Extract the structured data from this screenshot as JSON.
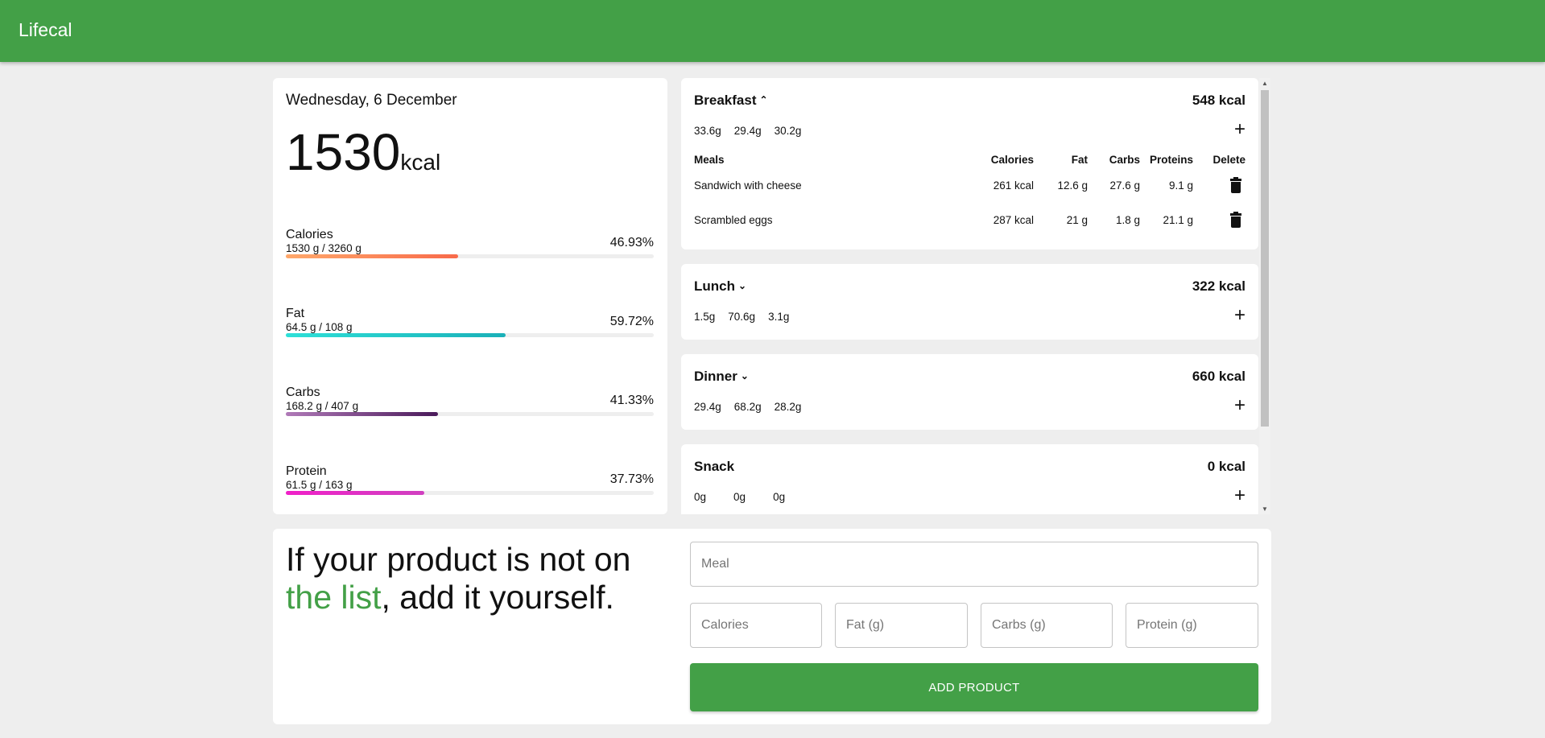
{
  "app": {
    "title": "Lifecal"
  },
  "summary": {
    "date": "Wednesday, 6 December",
    "kcal_value": "1530",
    "kcal_unit": "kcal",
    "stats": [
      {
        "name": "Calories",
        "amount": "1530 g / 3260 g",
        "percent": "46.93%",
        "fill": 0.4693,
        "gradient": [
          "#ffa86b",
          "#f86a4a"
        ]
      },
      {
        "name": "Fat",
        "amount": "64.5 g / 108 g",
        "percent": "59.72%",
        "fill": 0.5972,
        "gradient": [
          "#2ee0d8",
          "#1ab0b8"
        ]
      },
      {
        "name": "Carbs",
        "amount": "168.2 g / 407 g",
        "percent": "41.33%",
        "fill": 0.4133,
        "gradient": [
          "#b07ab8",
          "#4a1a5a"
        ]
      },
      {
        "name": "Protein",
        "amount": "61.5 g / 163 g",
        "percent": "37.73%",
        "fill": 0.3773,
        "gradient": [
          "#f020c8",
          "#d040c0"
        ]
      }
    ]
  },
  "meals": [
    {
      "name": "Breakfast",
      "expanded": true,
      "kcal": "548 kcal",
      "macros": [
        "33.6g",
        "29.4g",
        "30.2g"
      ],
      "table": {
        "headers": [
          "Meals",
          "Calories",
          "Fat",
          "Carbs",
          "Proteins",
          "Delete"
        ],
        "rows": [
          {
            "meal": "Sandwich with cheese",
            "calories": "261 kcal",
            "fat": "12.6 g",
            "carbs": "27.6 g",
            "proteins": "9.1 g"
          },
          {
            "meal": "Scrambled eggs",
            "calories": "287 kcal",
            "fat": "21 g",
            "carbs": "1.8 g",
            "proteins": "21.1 g"
          }
        ]
      }
    },
    {
      "name": "Lunch",
      "expanded": false,
      "kcal": "322 kcal",
      "macros": [
        "1.5g",
        "70.6g",
        "3.1g"
      ]
    },
    {
      "name": "Dinner",
      "expanded": false,
      "kcal": "660 kcal",
      "macros": [
        "29.4g",
        "68.2g",
        "28.2g"
      ]
    },
    {
      "name": "Snack",
      "expanded": false,
      "kcal": "0 kcal",
      "macros": [
        "0g",
        "0g",
        "0g"
      ]
    }
  ],
  "icons": {
    "chevron_up": "chevron-up-icon",
    "chevron_down": "chevron-down-icon",
    "plus": "plus-icon",
    "trash": "trash-icon"
  },
  "add_product": {
    "slogan_start": "If your product is not on ",
    "slogan_accent": "the list",
    "slogan_end": ", add it yourself.",
    "meal_placeholder": "Meal",
    "calories_placeholder": "Calories",
    "fat_placeholder": "Fat (g)",
    "carbs_placeholder": "Carbs (g)",
    "protein_placeholder": "Protein (g)",
    "button_label": "ADD PRODUCT"
  },
  "colors": {
    "brand": "#43a047",
    "background": "#eeeeee"
  }
}
